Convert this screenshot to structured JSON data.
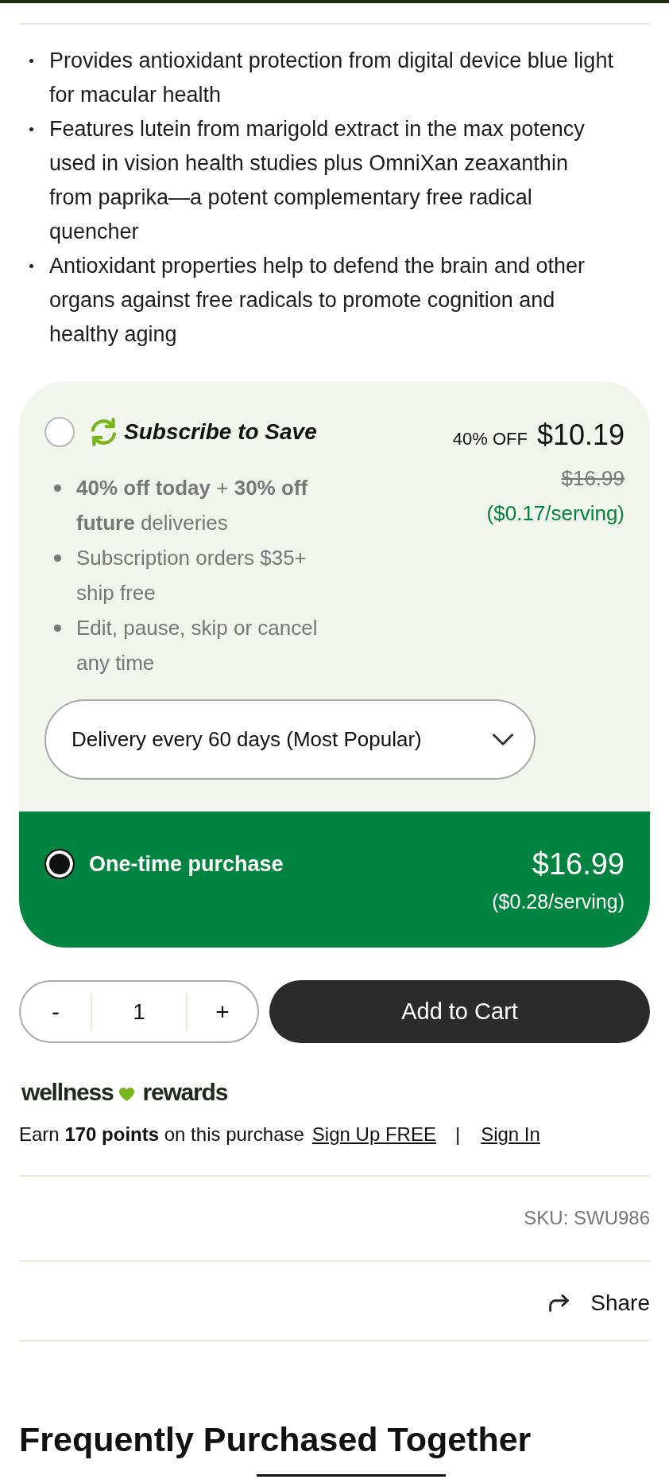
{
  "features": [
    "Provides antioxidant protection from digital device blue light for macular health",
    "Features lutein from marigold extract in the max potency used in vision health studies plus OmniXan zeaxanthin from paprika—a potent complementary free radical quencher",
    "Antioxidant properties help to defend the brain and other organs against free radicals to promote cognition and healthy aging"
  ],
  "purchase_options": [
    {
      "kind": "subscription",
      "selected": false,
      "title": "Subscribe to Save",
      "discount": "40% OFF",
      "price": "$10.19",
      "original_price": "$16.99",
      "per_serving": "($0.17/serving)",
      "benefits": [
        "**40% off today** + **30% off future** deliveries",
        "Subscription orders $35+ ship free",
        "Edit, pause, skip or cancel any time"
      ],
      "frequency": "Delivery every 60 days (Most Popular)"
    },
    {
      "kind": "one_time",
      "selected": true,
      "title": "One-time purchase",
      "price": "$16.99",
      "per_serving": "($0.28/serving)"
    }
  ],
  "quantity": {
    "decrement": "-",
    "value": "1",
    "increment": "+"
  },
  "add_to_cart": "Add to Cart",
  "rewards": {
    "logo": [
      "wellness",
      "rewards"
    ],
    "message": "Earn **170 points** on this purchase",
    "links": [
      "Sign Up FREE",
      "Sign In"
    ],
    "separator": "|"
  },
  "sku": "SKU: SWU986",
  "share": "Share",
  "heading": "Frequently Purchased Together"
}
